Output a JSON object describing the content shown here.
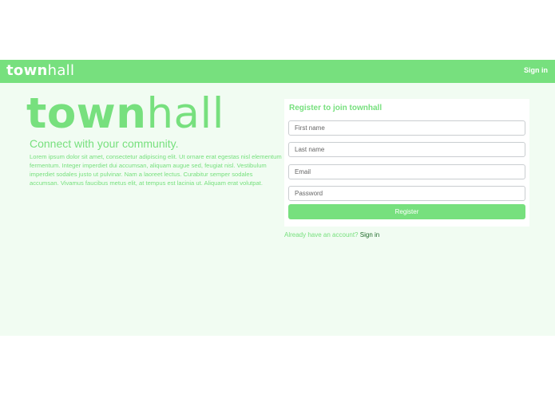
{
  "navbar": {
    "logo_bold": "town",
    "logo_light": "hall",
    "signin_label": "Sign in"
  },
  "hero": {
    "logo_bold": "town",
    "logo_light": "hall",
    "tagline": "Connect with your community.",
    "body": "Lorem ipsum dolor sit amet, consectetur adipiscing elit. Ut ornare erat egestas nisl elementum fermentum. Integer imperdiet dui accumsan, aliquam augue sed, feugiat nisl. Vestibulum imperdiet sodales justo ut pulvinar. Nam a laoreet lectus. Curabitur semper sodales accumsan. Vivamus faucibus metus elit, at tempus est lacinia ut. Aliquam erat volutpat."
  },
  "register_form": {
    "title": "Register to join townhall",
    "first_name_placeholder": "First name",
    "last_name_placeholder": "Last name",
    "email_placeholder": "Email",
    "password_placeholder": "Password",
    "submit_label": "Register"
  },
  "footer_prompt": {
    "text": "Already have an account?",
    "link_label": "Sign in"
  },
  "colors": {
    "brand_green": "#77e07e",
    "content_background": "#f1fcf2",
    "link_dark_green": "#1f6b2a"
  }
}
